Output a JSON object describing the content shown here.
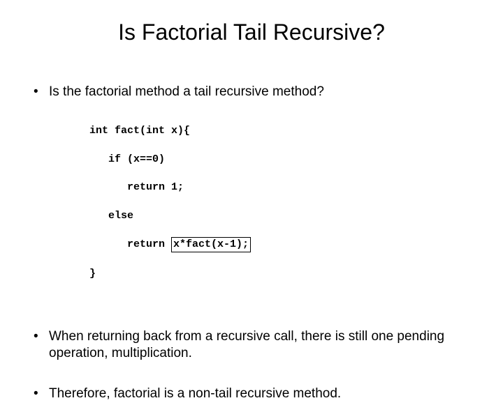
{
  "title": "Is Factorial Tail Recursive?",
  "bullets": {
    "b1": "Is the factorial method a tail recursive method?",
    "b2": "When returning back from a recursive call, there is still one pending operation, multiplication.",
    "b3": "Therefore, factorial is a non-tail recursive method."
  },
  "code": {
    "l1": "int fact(int x){",
    "l2": "   if (x==0)",
    "l3": "      return 1;",
    "l4": "   else",
    "l5a": "      return ",
    "l5b": "x*fact(x-1);",
    "l6": "}"
  }
}
